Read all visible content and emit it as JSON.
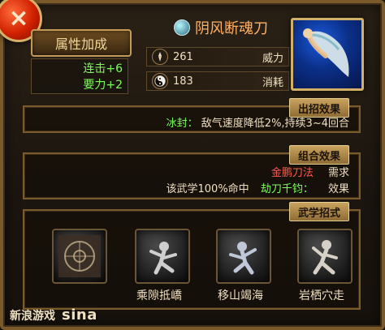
{
  "header": {
    "attribute_button_label": "属性加成",
    "bonus_lines": [
      "连击+6",
      "要力+2"
    ],
    "weapon_name": "阴风断魂刀",
    "stats": [
      {
        "icon": "sword-icon",
        "value": "261",
        "label": "威力"
      },
      {
        "icon": "yin-yang-icon",
        "value": "183",
        "label": "消耗"
      }
    ],
    "portrait_icon": "portrait-icon"
  },
  "panels": {
    "skill_effect": {
      "title": "出招效果",
      "prefix": "冰封：",
      "text": "敌气速度降低2%,持续3~4回合"
    },
    "combo_effect": {
      "title": "组合效果",
      "need_label": "需求",
      "need_value": "金鹏刀法",
      "effect_label": "效果",
      "effect_prefix": "劫刀千钧：",
      "effect_value": "该武学100%命中"
    },
    "martial_moves": {
      "title": "武学招式",
      "moves": [
        {
          "label": "",
          "icon": "rune-icon"
        },
        {
          "label": "乘隙抵嶠",
          "icon": "figure-icon"
        },
        {
          "label": "移山竭海",
          "icon": "figure-icon"
        },
        {
          "label": "岩栖穴走",
          "icon": "figure-icon"
        }
      ]
    }
  },
  "footer": {
    "brand_logo_text": "sina",
    "brand_text": "新浪游戏"
  },
  "colors": {
    "accent_gold": "#c8a25e",
    "highlight_green": "#7cff5a",
    "highlight_red": "#ff5a4a"
  }
}
